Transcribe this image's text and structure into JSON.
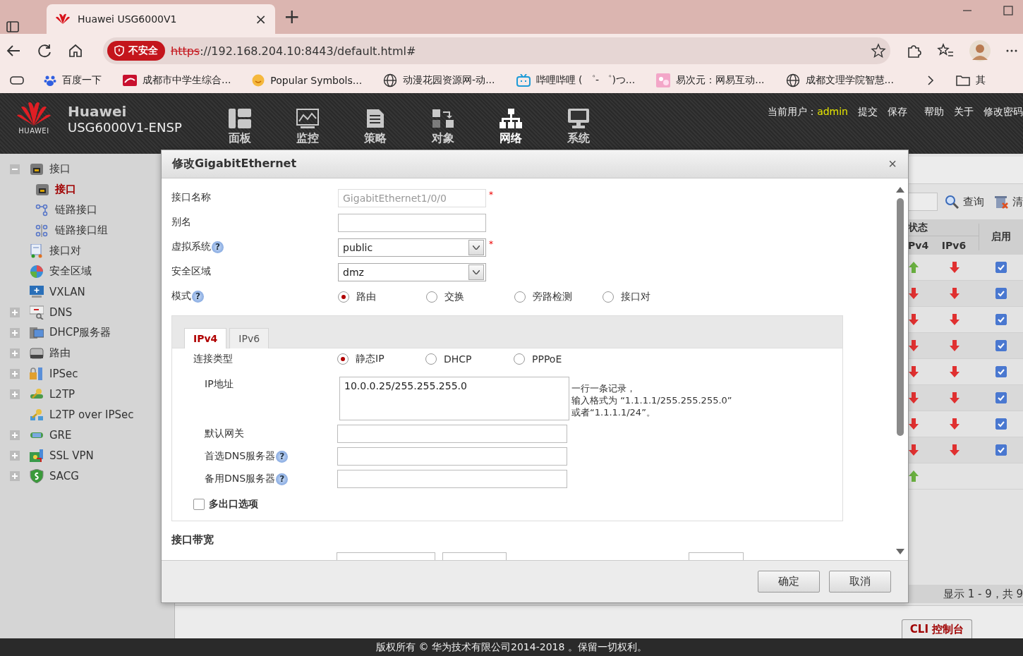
{
  "browser": {
    "tab_title": "Huawei USG6000V1",
    "tab_close": "×",
    "new_tab": "+",
    "security_badge": "不安全",
    "url_scheme": "https",
    "url_rest": "://192.168.204.10:8443/default.html#",
    "bookmarks": [
      "百度一下",
      "成都市中学生综合...",
      "Popular Symbols...",
      "动漫花园资源网-动...",
      "哔哩哔哩 ( ゜- ゜)つ...",
      "易次元：网易互动...",
      "成都文理学院智慧..."
    ],
    "other_bookmarks": "其"
  },
  "header": {
    "logo_text": "HUAWEI",
    "brand": "Huawei",
    "product": "USG6000V1-ENSP",
    "nav": [
      {
        "label": "面板",
        "selected": false
      },
      {
        "label": "监控",
        "selected": false
      },
      {
        "label": "策略",
        "selected": false
      },
      {
        "label": "对象",
        "selected": false
      },
      {
        "label": "网络",
        "selected": true
      },
      {
        "label": "系统",
        "selected": false
      }
    ],
    "user_label": "当前用户：",
    "user": "admin",
    "links": [
      "提交",
      "保存",
      "帮助",
      "关于",
      "修改密码"
    ]
  },
  "tree": [
    {
      "label": "接口",
      "expanded": true,
      "selected": false,
      "children": [
        {
          "label": "接口",
          "selected": true
        },
        {
          "label": "链路接口",
          "selected": false
        },
        {
          "label": "链路接口组",
          "selected": false
        }
      ]
    },
    {
      "label": "接口对",
      "selected": false
    },
    {
      "label": "安全区域",
      "selected": false
    },
    {
      "label": "VXLAN",
      "selected": false
    },
    {
      "label": "DNS",
      "expanded": false,
      "selected": false
    },
    {
      "label": "DHCP服务器",
      "expanded": false,
      "selected": false
    },
    {
      "label": "路由",
      "expanded": false,
      "selected": false
    },
    {
      "label": "IPSec",
      "expanded": false,
      "selected": false
    },
    {
      "label": "L2TP",
      "expanded": false,
      "selected": false
    },
    {
      "label": "L2TP over IPSec",
      "selected": false
    },
    {
      "label": "GRE",
      "expanded": false,
      "selected": false
    },
    {
      "label": "SSL VPN",
      "expanded": false,
      "selected": false
    },
    {
      "label": "SACG",
      "expanded": false,
      "selected": false
    }
  ],
  "page": {
    "search_button": "查询",
    "clear_button": "清",
    "columns": {
      "status": "状态",
      "ipv4": "Pv4",
      "ipv6": "IPv6",
      "enabled": "启用"
    },
    "rows": [
      {
        "ipv4_up": true,
        "ipv6_up": false,
        "enabled": true
      },
      {
        "ipv4_up": false,
        "ipv6_up": false,
        "enabled": true
      },
      {
        "ipv4_up": false,
        "ipv6_up": false,
        "enabled": true
      },
      {
        "ipv4_up": false,
        "ipv6_up": false,
        "enabled": true
      },
      {
        "ipv4_up": false,
        "ipv6_up": false,
        "enabled": true
      },
      {
        "ipv4_up": false,
        "ipv6_up": false,
        "enabled": true
      },
      {
        "ipv4_up": false,
        "ipv6_up": false,
        "enabled": true
      },
      {
        "ipv4_up": false,
        "ipv6_up": false,
        "enabled": true
      },
      {
        "ipv4_up": true
      }
    ],
    "pager": "显示 1 - 9，共 9",
    "cli_tab": "CLI 控制台"
  },
  "dialog": {
    "title": "修改GigabitEthernet",
    "close": "×",
    "fields": [
      {
        "kind": "text",
        "label": "接口名称",
        "value": "GigabitEthernet1/0/0",
        "disabled": true,
        "required_mark": "*"
      },
      {
        "kind": "text",
        "label": "别名",
        "disabled": false
      },
      {
        "kind": "select",
        "label": "虚拟系统",
        "help": "?",
        "value": "public",
        "required_mark": "*"
      },
      {
        "kind": "select",
        "label": "安全区域",
        "value": "dmz"
      },
      {
        "kind": "radio",
        "label": "模式",
        "help": "?",
        "options": [
          {
            "label": "路由",
            "selected": true
          },
          {
            "label": "交换",
            "selected": false
          },
          {
            "label": "旁路检测",
            "selected": false
          },
          {
            "label": "接口对",
            "selected": false
          }
        ]
      }
    ],
    "tabs": [
      {
        "label": "IPv4",
        "selected": true
      },
      {
        "label": "IPv6",
        "selected": false
      }
    ],
    "connection": {
      "label": "连接类型",
      "options": [
        {
          "label": "静态IP",
          "selected": true
        },
        {
          "label": "DHCP",
          "selected": false
        },
        {
          "label": "PPPoE",
          "selected": false
        }
      ]
    },
    "ip": {
      "label": "IP地址",
      "value": "10.0.0.25/255.255.255.0",
      "hint_lines": [
        "一行一条记录，",
        "输入格式为 “1.1.1.1/255.255.255.0”",
        "或者“1.1.1.1/24”。"
      ]
    },
    "inputs": [
      {
        "label": "默认网关"
      },
      {
        "label": "首选DNS服务器",
        "help": "?"
      },
      {
        "label": "备用DNS服务器",
        "help": "?"
      }
    ],
    "multi_exit": {
      "label": "多出口选项",
      "checked": false
    },
    "bandwidth_title": "接口带宽",
    "buttons": [
      "确定",
      "取消"
    ]
  },
  "footer": "版权所有 © 华为技术有限公司2014-2018 。保留一切权利。"
}
